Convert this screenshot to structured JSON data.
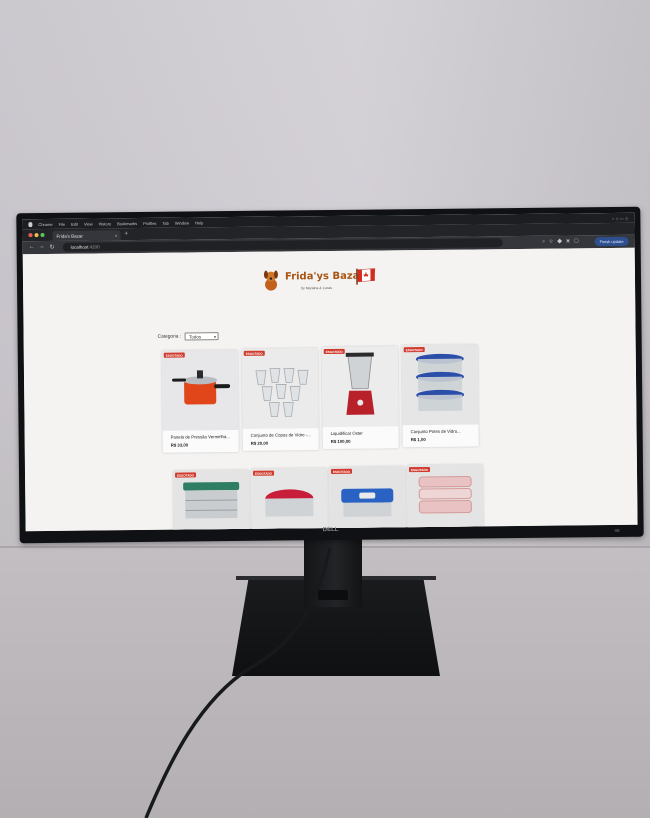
{
  "menubar": {
    "app": "Chrome",
    "items": [
      "File",
      "Edit",
      "View",
      "History",
      "Bookmarks",
      "Profiles",
      "Tab",
      "Window",
      "Help"
    ]
  },
  "browser": {
    "tab_title": "Frida's Bazar",
    "url_host": "localhost",
    "url_port": ":4200",
    "profile_label": "Finish update"
  },
  "page": {
    "brand_title": "Frida'ys Bazar",
    "brand_subtitle": "by Mariana & Lucas",
    "filter_label": "Categoria :",
    "filter_value": "Todos",
    "badge_text": "ESGOTADO",
    "products": [
      {
        "name": "Panela de Pressão Vermelha...",
        "price": "R$ 33,00"
      },
      {
        "name": "Conjunto de Copos de Vidro -...",
        "price": "R$ 20,00"
      },
      {
        "name": "Liquidificar Oster",
        "price": "R$ 100,00"
      },
      {
        "name": "Conjunto Potes de Vidro...",
        "price": "R$ 1,00"
      },
      {
        "name": "",
        "price": ""
      },
      {
        "name": "",
        "price": ""
      },
      {
        "name": "",
        "price": ""
      },
      {
        "name": "",
        "price": ""
      }
    ]
  },
  "monitor": {
    "brand": "DELL"
  },
  "colors": {
    "brand_orange": "#a85312",
    "badge_red": "#d13a2c",
    "chrome_dark": "#35363b",
    "page_bg": "#f4f3f1"
  }
}
